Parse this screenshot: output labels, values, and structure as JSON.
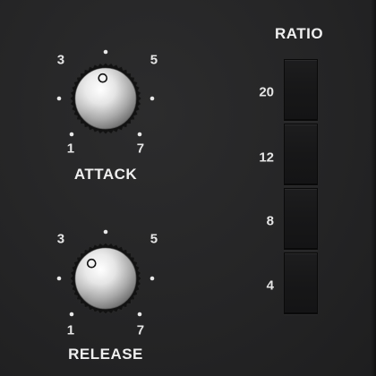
{
  "knobs": [
    {
      "name": "attack",
      "title": "ATTACK",
      "scale_labels": [
        "1",
        "3",
        "5",
        "7"
      ],
      "value_fraction": 0.47
    },
    {
      "name": "release",
      "title": "RELEASE",
      "scale_labels": [
        "1",
        "3",
        "5",
        "7"
      ],
      "value_fraction": 0.34
    }
  ],
  "ratio": {
    "title": "RATIO",
    "options": [
      "20",
      "12",
      "8",
      "4"
    ]
  },
  "colors": {
    "background": "#242425",
    "text": "#e6e6e6",
    "button": "#181819",
    "knob_metal": "#d9d9d9"
  }
}
